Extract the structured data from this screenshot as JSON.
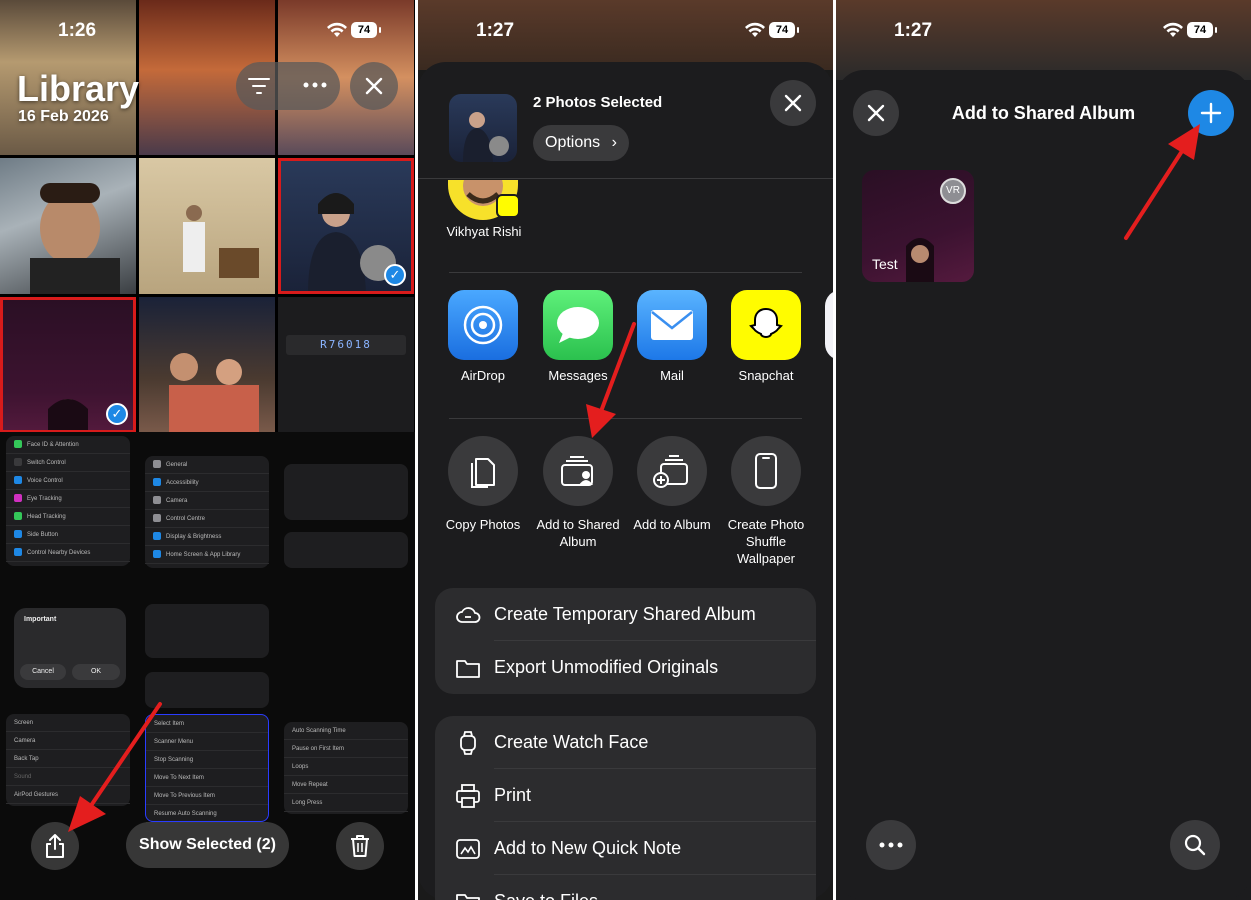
{
  "status_bar": [
    {
      "time": "1:26",
      "battery": "74"
    },
    {
      "time": "1:27",
      "battery": "74"
    },
    {
      "time": "1:27",
      "battery": "74"
    }
  ],
  "library": {
    "title": "Library",
    "date": "16 Feb 2026",
    "show_selected_label": "Show Selected (2)",
    "code_text": "R76018",
    "settings_rows": [
      "Face ID & Attention",
      "Switch Control",
      "Voice Control",
      "Eye Tracking",
      "Head Tracking",
      "Side Button",
      "Control Nearby Devices"
    ],
    "settings_rows_2": [
      "General",
      "Accessibility",
      "Camera",
      "Control Centre",
      "Display & Brightness",
      "Home Screen & App Library"
    ],
    "settings_rows_3": [
      "Screen",
      "Camera",
      "Back Tap",
      "Sound",
      "AirPod Gestures"
    ],
    "settings_rows_4": [
      "Select Item",
      "Scanner Menu",
      "Stop Scanning",
      "Move To Next Item",
      "Move To Previous Item",
      "Resume Auto Scanning"
    ],
    "settings_rows_5": [
      "Auto Scanning Time",
      "Pause on First Item",
      "Loops",
      "Move Repeat",
      "Long Press"
    ],
    "dialog_title": "Important",
    "dialog_cancel": "Cancel",
    "dialog_ok": "OK"
  },
  "share_sheet": {
    "title": "2 Photos Selected",
    "options_label": "Options",
    "contact_name": "Vikhyat Rishi",
    "apps": [
      {
        "label": "AirDrop",
        "color": "#1a73e8"
      },
      {
        "label": "Messages",
        "color": "#34c759"
      },
      {
        "label": "Mail",
        "color": "#2d8cf0"
      },
      {
        "label": "Snapchat",
        "color": "#fffc00"
      }
    ],
    "actions": [
      {
        "label": "Copy Photos"
      },
      {
        "label": "Add to Shared Album"
      },
      {
        "label": "Add to Album"
      },
      {
        "label": "Create Photo Shuffle Wallpaper"
      }
    ],
    "menu_group_1": [
      {
        "label": "Create Temporary Shared Album",
        "icon": "link-cloud-icon"
      },
      {
        "label": "Export Unmodified Originals",
        "icon": "folder-icon"
      }
    ],
    "menu_group_2": [
      {
        "label": "Create Watch Face",
        "icon": "watch-icon"
      },
      {
        "label": "Print",
        "icon": "printer-icon"
      },
      {
        "label": "Add to New Quick Note",
        "icon": "quick-note-icon"
      },
      {
        "label": "Save to Files",
        "icon": "folder-icon"
      }
    ]
  },
  "shared_album": {
    "title": "Add to Shared Album",
    "album_name": "Test",
    "album_initials": "VR",
    "accent": "#1e88e5"
  }
}
